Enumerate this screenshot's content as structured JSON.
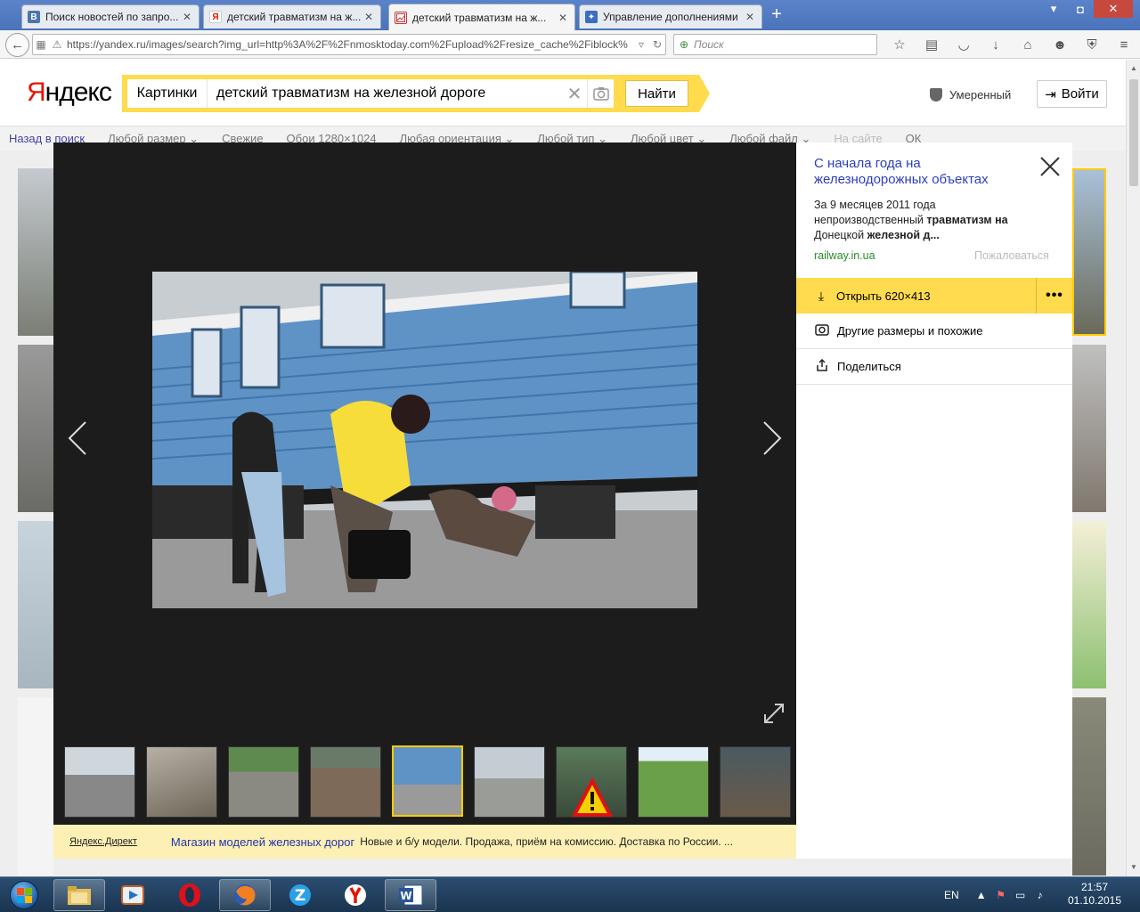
{
  "browser": {
    "tabs": [
      {
        "title": "Поиск новостей по запро...",
        "favicon": "B",
        "favicon_color": "#4a76a8"
      },
      {
        "title": "детский травматизм на ж...",
        "favicon": "Я",
        "favicon_color": "#e61400"
      },
      {
        "title": "детский травматизм на ж...",
        "favicon": "img",
        "favicon_color": "#c33"
      },
      {
        "title": "Управление дополнениями",
        "favicon": "puzzle",
        "favicon_color": "#3b6fc4"
      }
    ],
    "url": "https://yandex.ru/images/search?img_url=http%3A%2F%2Fnmosktoday.com%2Fupload%2Fresize_cache%2Fiblock%",
    "search_placeholder": "Поиск"
  },
  "header": {
    "logo_first": "Я",
    "logo_rest": "ндекс",
    "service": "Картинки",
    "query": "детский травматизм на железной дороге",
    "search_button": "Найти",
    "safe_search": "Умеренный",
    "login": "Войти"
  },
  "filters": [
    "Назад в поиск",
    "Любой размер ⌄",
    "Свежие",
    "Обои 1280×1024",
    "Любая ориентация ⌄",
    "Любой тип ⌄",
    "Любой цвет ⌄",
    "Любой файл ⌄",
    "На сайте",
    "ОК"
  ],
  "panel": {
    "title": "С начала года на железнодорожных объектах",
    "desc_1": "За 9 месяцев 2011 года непроизводственный ",
    "desc_b1": "травматизм на",
    "desc_2": " Донецкой ",
    "desc_b2": "железной д...",
    "domain": "railway.in.ua",
    "report": "Пожаловаться",
    "open_label": "Открыть 620×413",
    "more": "•••",
    "similar": "Другие размеры и похожие",
    "share": "Поделиться"
  },
  "direct": {
    "label": "Яндекс.Директ",
    "link": "Магазин моделей железных дорог",
    "text": "Новые и б/у модели. Продажа, приём на комиссию. Доставка по России. ..."
  },
  "taskbar": {
    "lang": "EN",
    "time": "21:57",
    "date": "01.10.2015"
  },
  "colors": {
    "yandex_yellow": "#ffdb4d",
    "link_blue": "#2a3fbf",
    "domain_green": "#2a8a2a",
    "viewer_bg": "#1c1c1c"
  }
}
